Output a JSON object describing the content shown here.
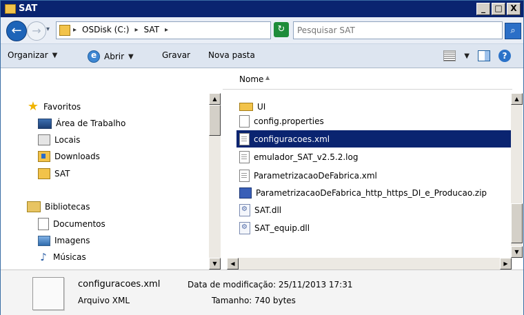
{
  "window": {
    "title": "SAT",
    "minimize": "_",
    "maximize": "□",
    "close": "X"
  },
  "address": {
    "segments": [
      "OSDisk (C:)",
      "SAT"
    ],
    "search_placeholder": "Pesquisar SAT"
  },
  "toolbar": {
    "organize": "Organizar",
    "open": "Abrir",
    "burn": "Gravar",
    "new_folder": "Nova pasta"
  },
  "sidebar": {
    "favorites": {
      "label": "Favoritos",
      "items": [
        "Área de Trabalho",
        "Locais",
        "Downloads",
        "SAT"
      ]
    },
    "libraries": {
      "label": "Bibliotecas",
      "items": [
        "Documentos",
        "Imagens",
        "Músicas"
      ]
    }
  },
  "file_list": {
    "column_name": "Nome",
    "partial_item": "UI",
    "rows": [
      {
        "name": "config.properties",
        "icon": "generic-file-icon"
      },
      {
        "name": "configuracoes.xml",
        "icon": "xml-file-icon",
        "selected": true
      },
      {
        "name": "emulador_SAT_v2.5.2.log",
        "icon": "text-file-icon"
      },
      {
        "name": "ParametrizacaoDeFabrica.xml",
        "icon": "xml-file-icon"
      },
      {
        "name": "ParametrizacaoDeFabrica_http_https_DI_e_Producao.zip",
        "icon": "zip-file-icon"
      },
      {
        "name": "SAT.dll",
        "icon": "dll-file-icon"
      },
      {
        "name": "SAT_equip.dll",
        "icon": "dll-file-icon"
      }
    ]
  },
  "details": {
    "name": "configuracoes.xml",
    "type": "Arquivo XML",
    "modified": "Data de modificação: 25/11/2013 17:31",
    "size": "Tamanho: 740 bytes"
  }
}
